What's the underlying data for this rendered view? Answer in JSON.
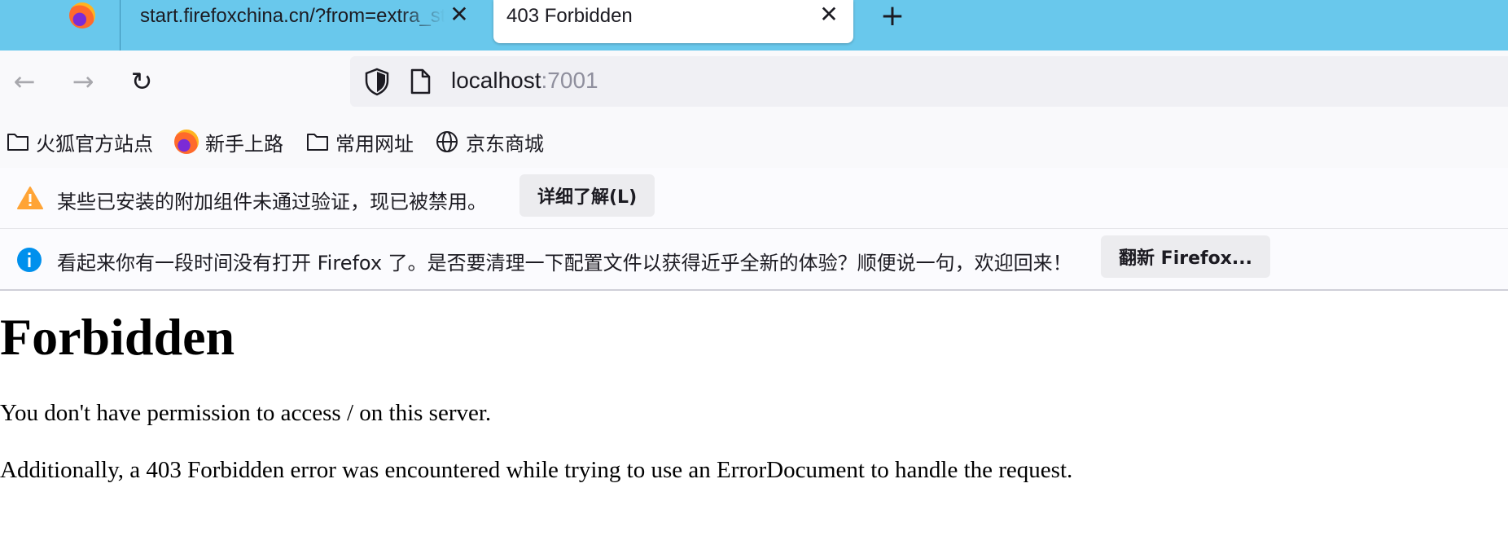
{
  "tabs": [
    {
      "title": "start.firefoxchina.cn/?from=extra_start",
      "active": false
    },
    {
      "title": "403 Forbidden",
      "active": true
    }
  ],
  "new_tab_label": "+",
  "nav": {
    "back_icon": "←",
    "forward_icon": "→",
    "reload_icon": "↻"
  },
  "url": {
    "host": "localhost",
    "port": ":7001"
  },
  "bookmarks": [
    {
      "label": "火狐官方站点",
      "icon": "folder-icon"
    },
    {
      "label": "新手上路",
      "icon": "firefox-icon"
    },
    {
      "label": "常用网址",
      "icon": "folder-icon"
    },
    {
      "label": "京东商城",
      "icon": "globe-icon"
    }
  ],
  "notices": [
    {
      "icon": "warning-icon",
      "text": "某些已安装的附加组件未通过验证，现已被禁用。",
      "button": "详细了解(L)"
    },
    {
      "icon": "info-icon",
      "text": "看起来你有一段时间没有打开 Firefox 了。是否要清理一下配置文件以获得近乎全新的体验？顺便说一句，欢迎回来！",
      "button": "翻新 Firefox..."
    }
  ],
  "page": {
    "heading": "Forbidden",
    "paragraph1": "You don't have permission to access / on this server.",
    "paragraph2": "Additionally, a 403 Forbidden error was encountered while trying to use an ErrorDocument to handle the request."
  },
  "colors": {
    "tabbar": "#69c8ec",
    "warning": "#ffa436",
    "info": "#0090ed"
  }
}
